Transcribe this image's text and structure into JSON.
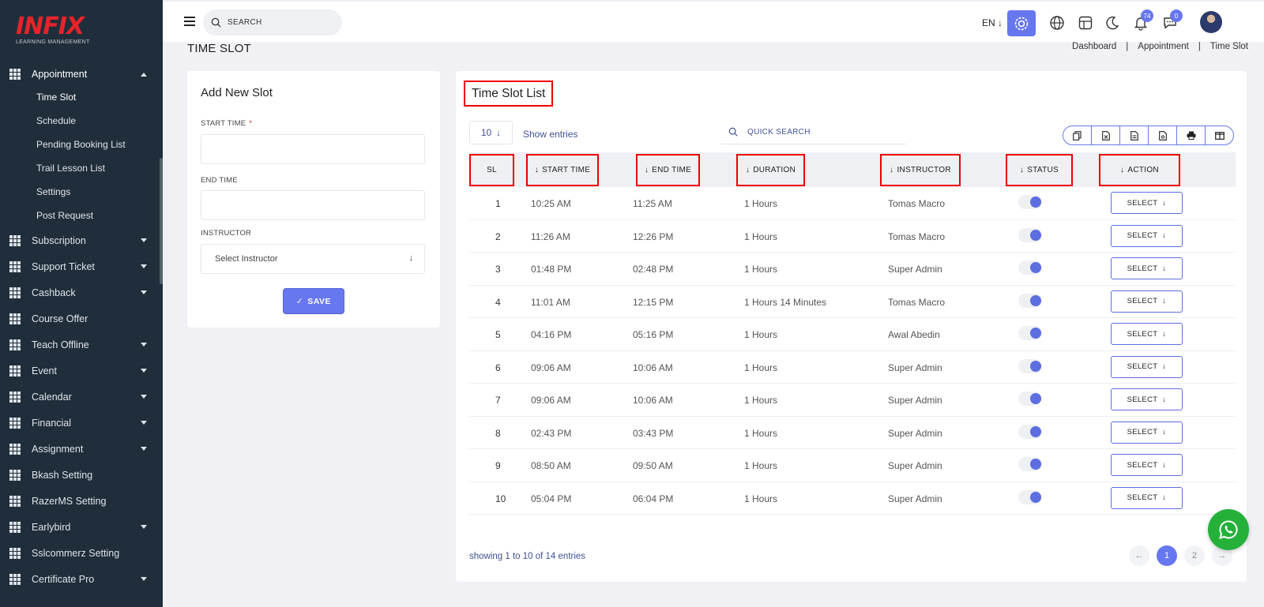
{
  "logo": {
    "brand": "INFIX",
    "subtitle": "LEARNING MANAGEMENT"
  },
  "sidebar": {
    "active_menu": "Appointment",
    "submenu": [
      "Time Slot",
      "Schedule",
      "Pending Booking List",
      "Trail Lesson List",
      "Settings",
      "Post Request"
    ],
    "items": [
      {
        "label": "Subscription",
        "caret": true
      },
      {
        "label": "Support Ticket",
        "caret": true
      },
      {
        "label": "Cashback",
        "caret": true
      },
      {
        "label": "Course Offer",
        "caret": false
      },
      {
        "label": "Teach Offline",
        "caret": true
      },
      {
        "label": "Event",
        "caret": true
      },
      {
        "label": "Calendar",
        "caret": true
      },
      {
        "label": "Financial",
        "caret": true
      },
      {
        "label": "Assignment",
        "caret": true
      },
      {
        "label": "Bkash Setting",
        "caret": false
      },
      {
        "label": "RazerMS Setting",
        "caret": false
      },
      {
        "label": "Earlybird",
        "caret": true
      },
      {
        "label": "Sslcommerz Setting",
        "caret": false
      },
      {
        "label": "Certificate Pro",
        "caret": true
      }
    ]
  },
  "header": {
    "search_placeholder": "SEARCH",
    "language": "EN",
    "notification_count": "74",
    "message_count": "0",
    "accent_color": "#6777ef"
  },
  "page": {
    "title": "TIME SLOT",
    "breadcrumb": [
      "Dashboard",
      "|",
      "Appointment",
      "|",
      "Time Slot"
    ]
  },
  "form": {
    "title": "Add New Slot",
    "start_time_label": "START TIME",
    "required_mark": "*",
    "end_time_label": "END TIME",
    "instructor_label": "INSTRUCTOR",
    "instructor_placeholder": "Select Instructor",
    "save_label": "SAVE"
  },
  "table": {
    "title": "Time Slot List",
    "entries_value": "10",
    "show_entries_label": "Show entries",
    "quick_search_placeholder": "QUICK SEARCH",
    "columns": [
      "SL",
      "START TIME",
      "END TIME",
      "DURATION",
      "INSTRUCTOR",
      "STATUS",
      "ACTION"
    ],
    "action_label": "SELECT",
    "rows": [
      {
        "sl": "1",
        "start": "10:25 AM",
        "end": "11:25 AM",
        "duration": "1 Hours",
        "instructor": "Tomas Macro",
        "status": "on"
      },
      {
        "sl": "2",
        "start": "11:26 AM",
        "end": "12:26 PM",
        "duration": "1 Hours",
        "instructor": "Tomas Macro",
        "status": "on"
      },
      {
        "sl": "3",
        "start": "01:48 PM",
        "end": "02:48 PM",
        "duration": "1 Hours",
        "instructor": "Super Admin",
        "status": "on"
      },
      {
        "sl": "4",
        "start": "11:01 AM",
        "end": "12:15 PM",
        "duration": "1 Hours 14 Minutes",
        "instructor": "Tomas Macro",
        "status": "on"
      },
      {
        "sl": "5",
        "start": "04:16 PM",
        "end": "05:16 PM",
        "duration": "1 Hours",
        "instructor": "Awal Abedin",
        "status": "on"
      },
      {
        "sl": "6",
        "start": "09:06 AM",
        "end": "10:06 AM",
        "duration": "1 Hours",
        "instructor": "Super Admin",
        "status": "on"
      },
      {
        "sl": "7",
        "start": "09:06 AM",
        "end": "10:06 AM",
        "duration": "1 Hours",
        "instructor": "Super Admin",
        "status": "on"
      },
      {
        "sl": "8",
        "start": "02:43 PM",
        "end": "03:43 PM",
        "duration": "1 Hours",
        "instructor": "Super Admin",
        "status": "on"
      },
      {
        "sl": "9",
        "start": "08:50 AM",
        "end": "09:50 AM",
        "duration": "1 Hours",
        "instructor": "Super Admin",
        "status": "on"
      },
      {
        "sl": "10",
        "start": "05:04 PM",
        "end": "06:04 PM",
        "duration": "1 Hours",
        "instructor": "Super Admin",
        "status": "on"
      }
    ],
    "showing_text": "showing 1 to 10 of 14 entries",
    "pages": [
      "1",
      "2"
    ],
    "current_page": "1"
  }
}
